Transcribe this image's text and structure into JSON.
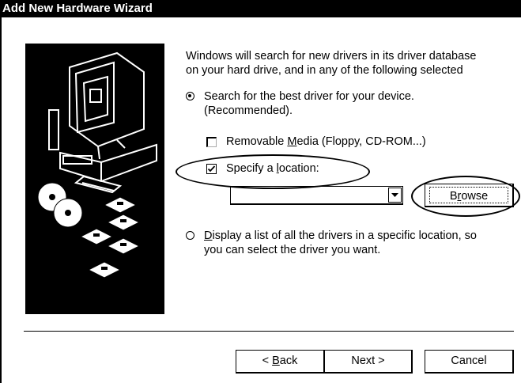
{
  "window": {
    "title": "Add New Hardware Wizard"
  },
  "intro": {
    "line1": "Windows will search for new drivers in its driver database",
    "line2": "on your hard drive, and in any of the following selected"
  },
  "option_search": {
    "line1": "Search for the best driver for your device.",
    "line2": "(Recommended).",
    "selected": true
  },
  "removable_media": {
    "pre": "Removable ",
    "mnemonic": "M",
    "post": "edia (Floppy, CD-ROM...)",
    "checked": false
  },
  "specify_location": {
    "pre": "Specify a ",
    "mnemonic": "l",
    "post": "ocation:",
    "checked": true
  },
  "location_input": {
    "value": ""
  },
  "browse_button": {
    "pre": "B",
    "mnemonic": "r",
    "post": "owse"
  },
  "option_display": {
    "mnemonic": "D",
    "line1_rest": "isplay a list of all the drivers in a specific location, so",
    "line2": "you can select the driver you want.",
    "selected": false
  },
  "buttons": {
    "back": {
      "pre": "< ",
      "mnemonic": "B",
      "post": "ack"
    },
    "next": "Next >",
    "cancel": "Cancel"
  },
  "icons": [
    "computer-icon",
    "cd-disc-icon",
    "floppy-disk-icon",
    "dropdown-arrow-icon"
  ]
}
